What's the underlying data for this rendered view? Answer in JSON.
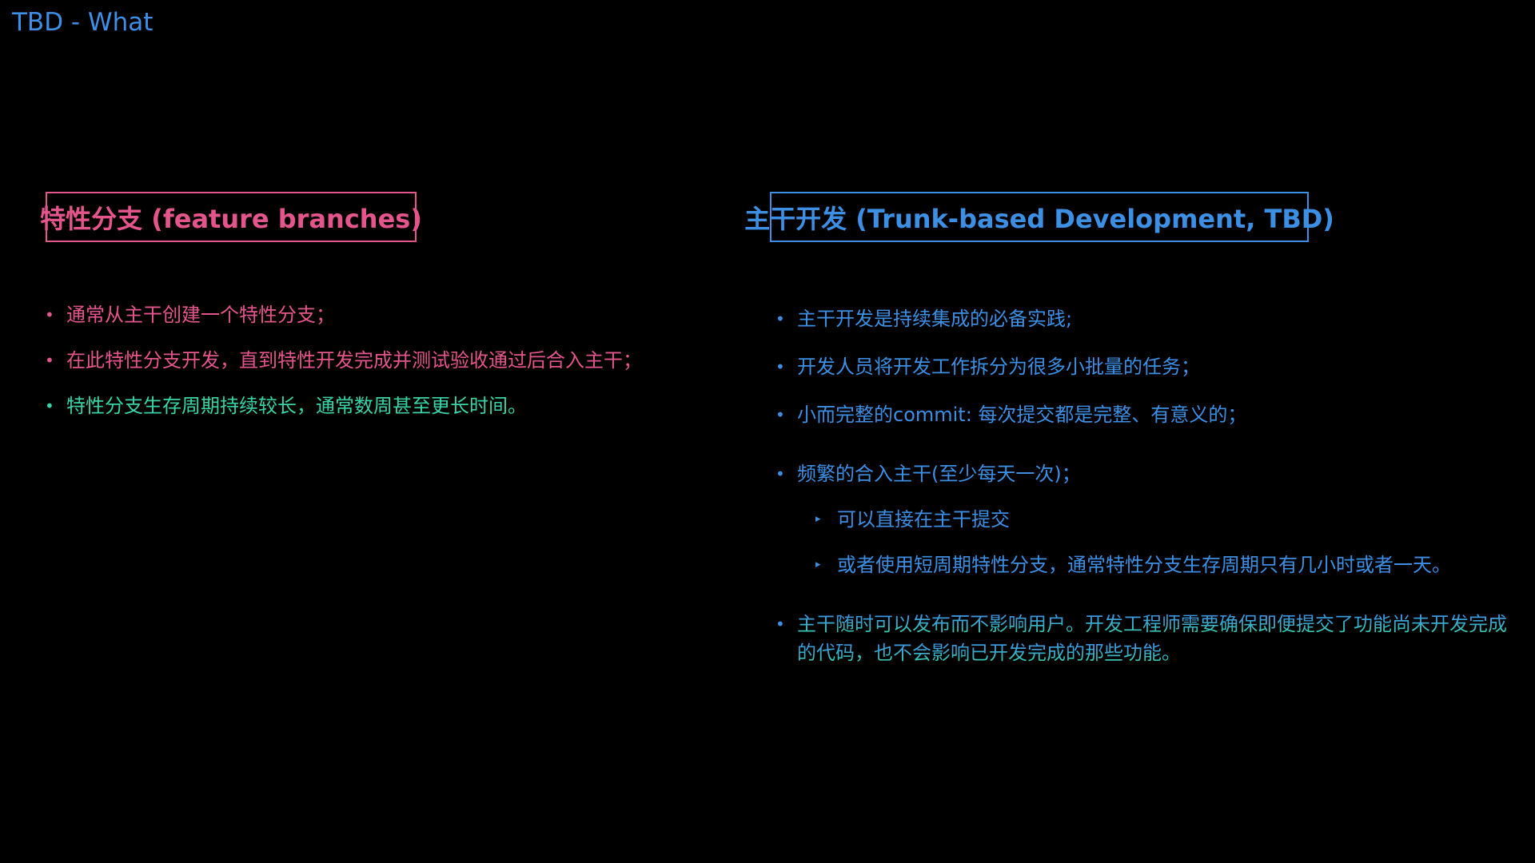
{
  "title": "TBD - What",
  "left": {
    "heading": "特性分支  (feature branches)",
    "items": [
      "通常从主干创建一个特性分支；",
      "在此特性分支开发，直到特性开发完成并测试验收通过后合入主干；",
      "特性分支生存周期持续较长，通常数周甚至更长时间。"
    ]
  },
  "right": {
    "heading": "主干开发 (Trunk-based Development, TBD)",
    "items": [
      "主干开发是持续集成的必备实践;",
      "开发人员将开发工作拆分为很多小批量的任务；",
      "小而完整的commit: 每次提交都是完整、有意义的；",
      "频繁的合入主干(至少每天一次)；",
      "主干随时可以发布而不影响用户。开发工程师需要确保即便提交了功能尚未开发完成的代码，也不会影响已开发完成的那些功能。"
    ],
    "sub_items": [
      "可以直接在主干提交",
      "或者使用短周期特性分支，通常特性分支生存周期只有几小时或者一天。"
    ]
  },
  "symbols": {
    "bullet": "•",
    "triangle": "▸"
  },
  "colors": {
    "title": "#3f8fe6",
    "feature_branch_accent": "#e4558c",
    "trunk_accent": "#3d8fe4",
    "highlight_green": "#38d4a8"
  }
}
